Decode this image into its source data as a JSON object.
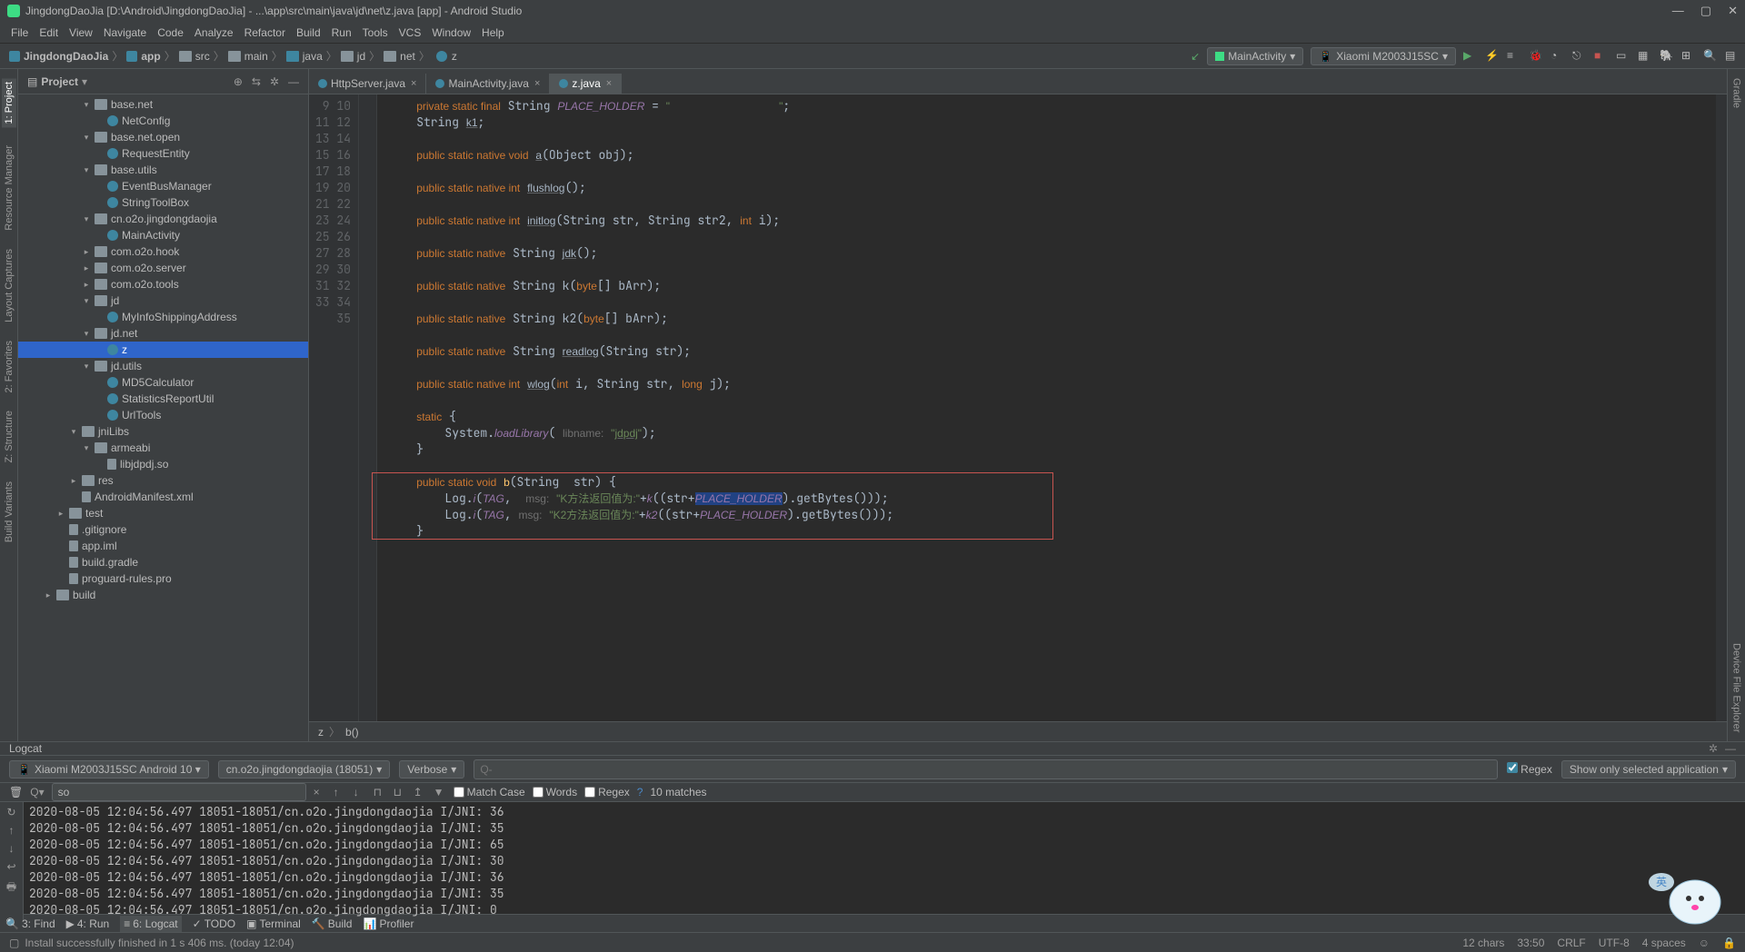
{
  "titlebar": {
    "title": "JingdongDaoJia [D:\\Android\\JingdongDaoJia] - ...\\app\\src\\main\\java\\jd\\net\\z.java [app] - Android Studio"
  },
  "menu": [
    "File",
    "Edit",
    "View",
    "Navigate",
    "Code",
    "Analyze",
    "Refactor",
    "Build",
    "Run",
    "Tools",
    "VCS",
    "Window",
    "Help"
  ],
  "navbar": {
    "crumbs": [
      "JingdongDaoJia",
      "app",
      "src",
      "main",
      "java",
      "jd",
      "net",
      "z"
    ],
    "run_config": "MainActivity",
    "device": "Xiaomi M2003J15SC"
  },
  "sidebar_left": [
    "1: Project",
    "Resource Manager",
    "Layout Captures",
    "2: Favorites",
    "Z: Structure",
    "Build Variants"
  ],
  "sidebar_right": [
    "Gradle",
    "Device File Explorer"
  ],
  "project_panel": {
    "title": "Project",
    "tree": [
      {
        "depth": 5,
        "arrow": "▾",
        "icon": "pkg",
        "label": "base.net"
      },
      {
        "depth": 6,
        "arrow": "",
        "icon": "cls",
        "label": "NetConfig"
      },
      {
        "depth": 5,
        "arrow": "▾",
        "icon": "pkg",
        "label": "base.net.open"
      },
      {
        "depth": 6,
        "arrow": "",
        "icon": "cls",
        "label": "RequestEntity"
      },
      {
        "depth": 5,
        "arrow": "▾",
        "icon": "pkg",
        "label": "base.utils"
      },
      {
        "depth": 6,
        "arrow": "",
        "icon": "cls",
        "label": "EventBusManager"
      },
      {
        "depth": 6,
        "arrow": "",
        "icon": "cls",
        "label": "StringToolBox"
      },
      {
        "depth": 5,
        "arrow": "▾",
        "icon": "pkg",
        "label": "cn.o2o.jingdongdaojia"
      },
      {
        "depth": 6,
        "arrow": "",
        "icon": "cls",
        "label": "MainActivity"
      },
      {
        "depth": 5,
        "arrow": "▸",
        "icon": "pkg",
        "label": "com.o2o.hook"
      },
      {
        "depth": 5,
        "arrow": "▸",
        "icon": "pkg",
        "label": "com.o2o.server"
      },
      {
        "depth": 5,
        "arrow": "▸",
        "icon": "pkg",
        "label": "com.o2o.tools"
      },
      {
        "depth": 5,
        "arrow": "▾",
        "icon": "pkg",
        "label": "jd"
      },
      {
        "depth": 6,
        "arrow": "",
        "icon": "cls",
        "label": "MyInfoShippingAddress"
      },
      {
        "depth": 5,
        "arrow": "▾",
        "icon": "pkg",
        "label": "jd.net"
      },
      {
        "depth": 6,
        "arrow": "",
        "icon": "cls",
        "label": "z",
        "sel": true
      },
      {
        "depth": 5,
        "arrow": "▾",
        "icon": "pkg",
        "label": "jd.utils"
      },
      {
        "depth": 6,
        "arrow": "",
        "icon": "cls",
        "label": "MD5Calculator"
      },
      {
        "depth": 6,
        "arrow": "",
        "icon": "cls",
        "label": "StatisticsReportUtil"
      },
      {
        "depth": 6,
        "arrow": "",
        "icon": "cls",
        "label": "UrlTools"
      },
      {
        "depth": 4,
        "arrow": "▾",
        "icon": "fld",
        "label": "jniLibs"
      },
      {
        "depth": 5,
        "arrow": "▾",
        "icon": "fld",
        "label": "armeabi"
      },
      {
        "depth": 6,
        "arrow": "",
        "icon": "file",
        "label": "libjdpdj.so"
      },
      {
        "depth": 4,
        "arrow": "▸",
        "icon": "fld",
        "label": "res"
      },
      {
        "depth": 4,
        "arrow": "",
        "icon": "file",
        "label": "AndroidManifest.xml"
      },
      {
        "depth": 3,
        "arrow": "▸",
        "icon": "fld",
        "label": "test"
      },
      {
        "depth": 3,
        "arrow": "",
        "icon": "file",
        "label": ".gitignore"
      },
      {
        "depth": 3,
        "arrow": "",
        "icon": "file",
        "label": "app.iml"
      },
      {
        "depth": 3,
        "arrow": "",
        "icon": "file",
        "label": "build.gradle"
      },
      {
        "depth": 3,
        "arrow": "",
        "icon": "file",
        "label": "proguard-rules.pro"
      },
      {
        "depth": 2,
        "arrow": "▸",
        "icon": "fld",
        "label": "build"
      }
    ]
  },
  "editor": {
    "tabs": [
      {
        "label": "HttpServer.java",
        "active": false
      },
      {
        "label": "MainActivity.java",
        "active": false
      },
      {
        "label": "z.java",
        "active": true
      }
    ],
    "line_start": 9,
    "line_end": 35,
    "breadcrumb": [
      "z",
      "b()"
    ]
  },
  "logcat": {
    "title": "Logcat",
    "device": "Xiaomi M2003J15SC Android 10 ▾",
    "process": "cn.o2o.jingdongdaojia (18051)",
    "level": "Verbose",
    "search_placeholder": "Q-",
    "regex_label": "Regex",
    "filter": "Show only selected application",
    "search2": "so",
    "match_case": "Match Case",
    "words": "Words",
    "regex2": "Regex",
    "matches": "10 matches",
    "lines": [
      "2020-08-05 12:04:56.497 18051-18051/cn.o2o.jingdongdaojia I/JNI: 36",
      "2020-08-05 12:04:56.497 18051-18051/cn.o2o.jingdongdaojia I/JNI: 35",
      "2020-08-05 12:04:56.497 18051-18051/cn.o2o.jingdongdaojia I/JNI: 65",
      "2020-08-05 12:04:56.497 18051-18051/cn.o2o.jingdongdaojia I/JNI: 30",
      "2020-08-05 12:04:56.497 18051-18051/cn.o2o.jingdongdaojia I/JNI: 36",
      "2020-08-05 12:04:56.497 18051-18051/cn.o2o.jingdongdaojia I/JNI: 35",
      "2020-08-05 12:04:56.497 18051-18051/cn.o2o.jingdongdaojia I/JNI: 0"
    ]
  },
  "bottom_bar": [
    "3: Find",
    "4: Run",
    "6: Logcat",
    "TODO",
    "Terminal",
    "Build",
    "Profiler"
  ],
  "status": {
    "msg": "Install successfully finished in 1 s 406 ms. (today 12:04)",
    "right": [
      "12 chars",
      "33:50",
      "CRLF",
      "UTF-8",
      "4 spaces"
    ]
  }
}
